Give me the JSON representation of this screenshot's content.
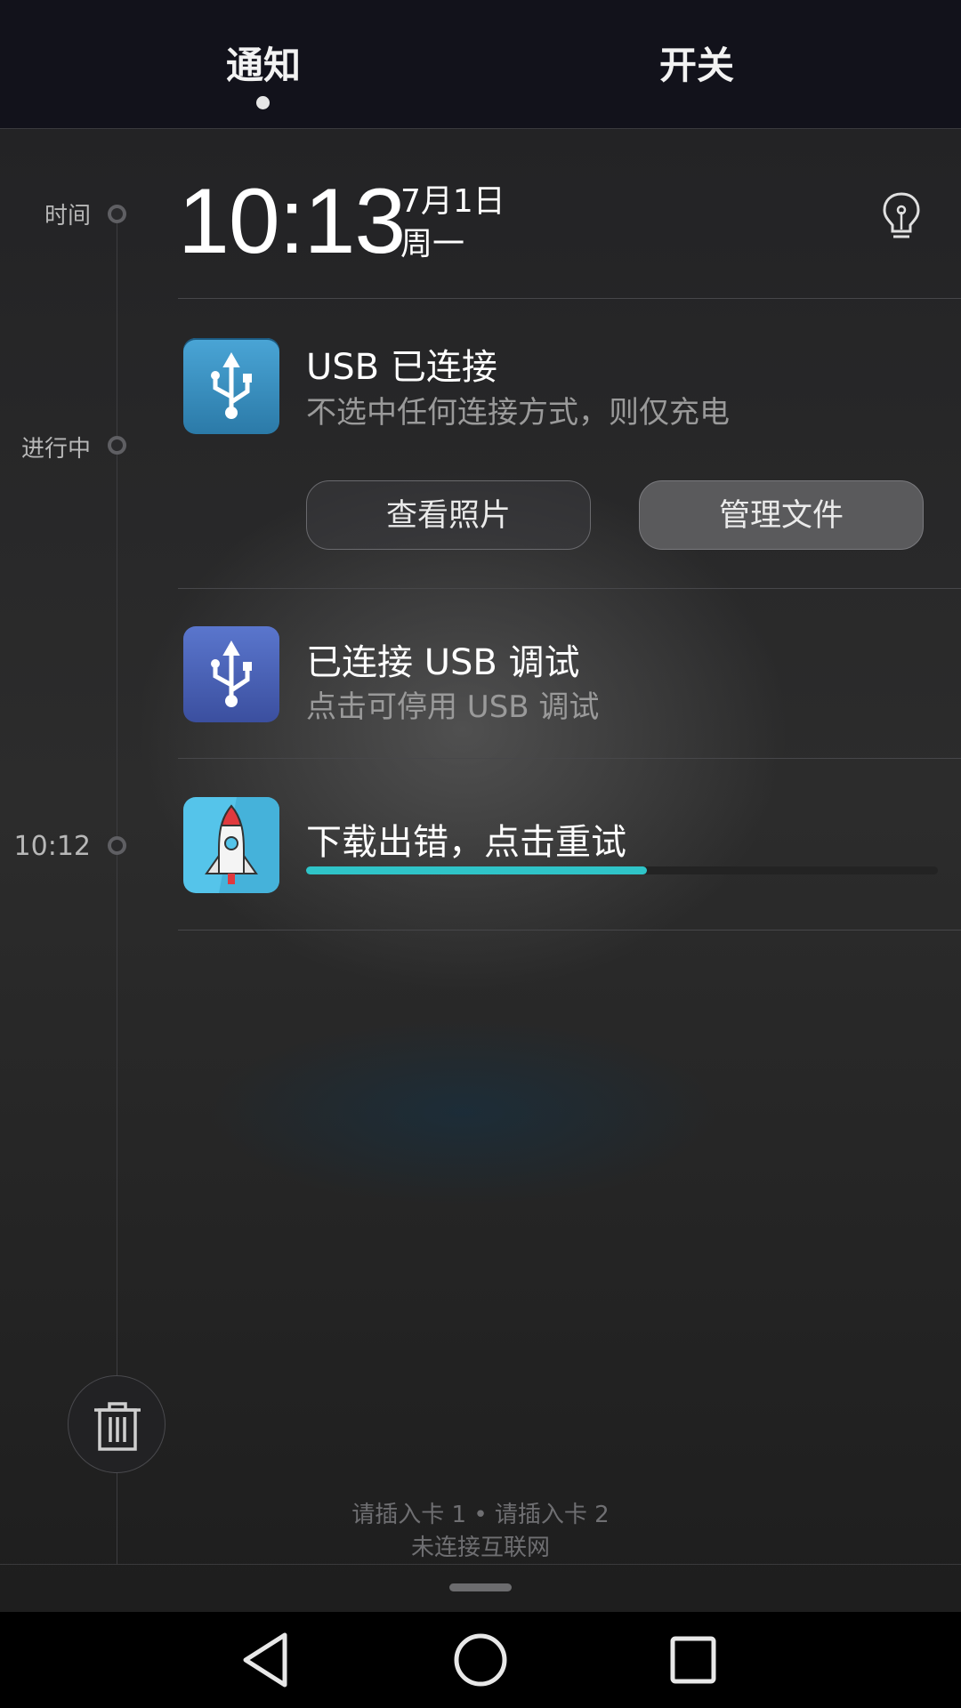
{
  "tabs": [
    {
      "label": "通知",
      "active": true
    },
    {
      "label": "开关",
      "active": false
    }
  ],
  "timeline": {
    "time_label": "时间",
    "ongoing_label": "进行中",
    "clock_label": "10:12"
  },
  "header": {
    "time": "10:13",
    "date": "7月1日",
    "weekday": "周一",
    "bulb_icon": "lightbulb-icon"
  },
  "notifications": [
    {
      "icon": "usb-icon",
      "title": "USB 已连接",
      "subtitle": "不选中任何连接方式，则仅充电",
      "actions": [
        "查看照片",
        "管理文件"
      ]
    },
    {
      "icon": "usb-icon",
      "title": "已连接 USB 调试",
      "subtitle": "点击可停用 USB 调试"
    },
    {
      "icon": "rocket-icon",
      "title": "下载出错，点击重试",
      "progress": 0.54
    }
  ],
  "footer": {
    "sim_status": "请插入卡 1 • 请插入卡 2",
    "network_status": "未连接互联网"
  },
  "colors": {
    "accent": "#2fc4c8",
    "usb_icon_bg": "#3a8fc2",
    "usb_debug_icon_bg": "#4a5fb6",
    "rocket_icon_bg": "#55c4ea"
  }
}
